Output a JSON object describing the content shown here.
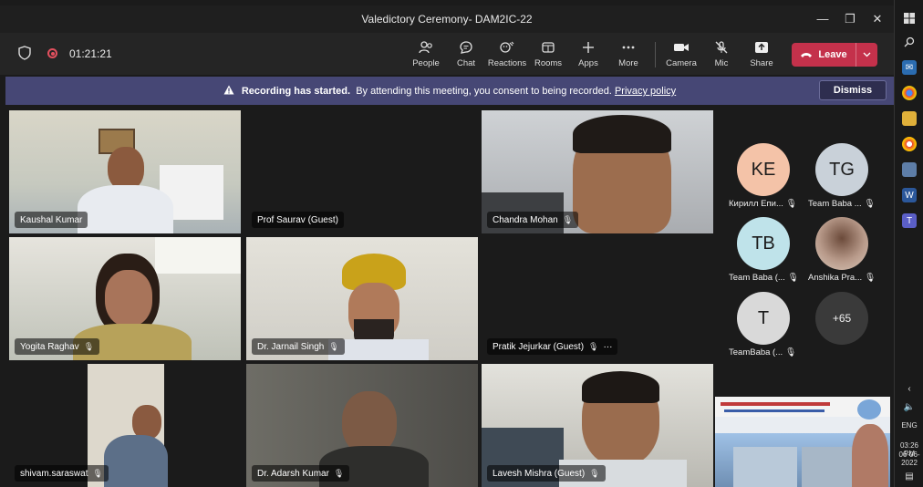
{
  "window": {
    "title": "Valedictory Ceremony- DAM2IC-22",
    "minimize": "—",
    "maximize": "❐",
    "close": "✕"
  },
  "toolbar": {
    "timer": "01:21:21",
    "buttons": [
      {
        "label": "People",
        "icon": "people-icon"
      },
      {
        "label": "Chat",
        "icon": "chat-icon"
      },
      {
        "label": "Reactions",
        "icon": "reactions-icon"
      },
      {
        "label": "Rooms",
        "icon": "rooms-icon"
      },
      {
        "label": "Apps",
        "icon": "apps-icon"
      },
      {
        "label": "More",
        "icon": "more-icon"
      },
      {
        "label": "Camera",
        "icon": "camera-icon"
      },
      {
        "label": "Mic",
        "icon": "mic-off-icon"
      },
      {
        "label": "Share",
        "icon": "share-icon"
      }
    ],
    "leave_label": "Leave"
  },
  "banner": {
    "bold": "Recording has started.",
    "text": "By attending this meeting, you consent to being recorded.",
    "link": "Privacy policy",
    "dismiss": "Dismiss"
  },
  "participants": [
    {
      "name": "Kaushal Kumar"
    },
    {
      "name": "Prof Saurav (Guest)"
    },
    {
      "name": "Chandra Mohan"
    },
    {
      "name": "Yogita Raghav"
    },
    {
      "name": "Dr. Jarnail Singh"
    },
    {
      "name": "Pratik Jejurkar (Guest)"
    },
    {
      "name": "shivam.saraswat"
    },
    {
      "name": "Dr. Adarsh Kumar"
    },
    {
      "name": "Lavesh Mishra (Guest)"
    }
  ],
  "side_participants": [
    {
      "initials": "KE",
      "name": "Кирилл Епи...",
      "color": "#f4c3a8"
    },
    {
      "initials": "TG",
      "name": "Team Baba ...",
      "color": "#c9d1d9"
    },
    {
      "initials": "TB",
      "name": "Team Baba (...",
      "color": "#bfe3ea"
    },
    {
      "initials": "",
      "name": "Anshika Pra...",
      "color": "#b89a8a"
    },
    {
      "initials": "T",
      "name": "TeamBaba (...",
      "color": "#d9d9d9"
    },
    {
      "initials": "+65",
      "name": "",
      "color": "#3a3a3a"
    }
  ],
  "taskbar": {
    "lang": "ENG",
    "time": "03:26 PM",
    "date": "06-06-2022"
  },
  "colors": {
    "accent": "#464775",
    "leave": "#c4314b",
    "recording": "#e2505e"
  }
}
